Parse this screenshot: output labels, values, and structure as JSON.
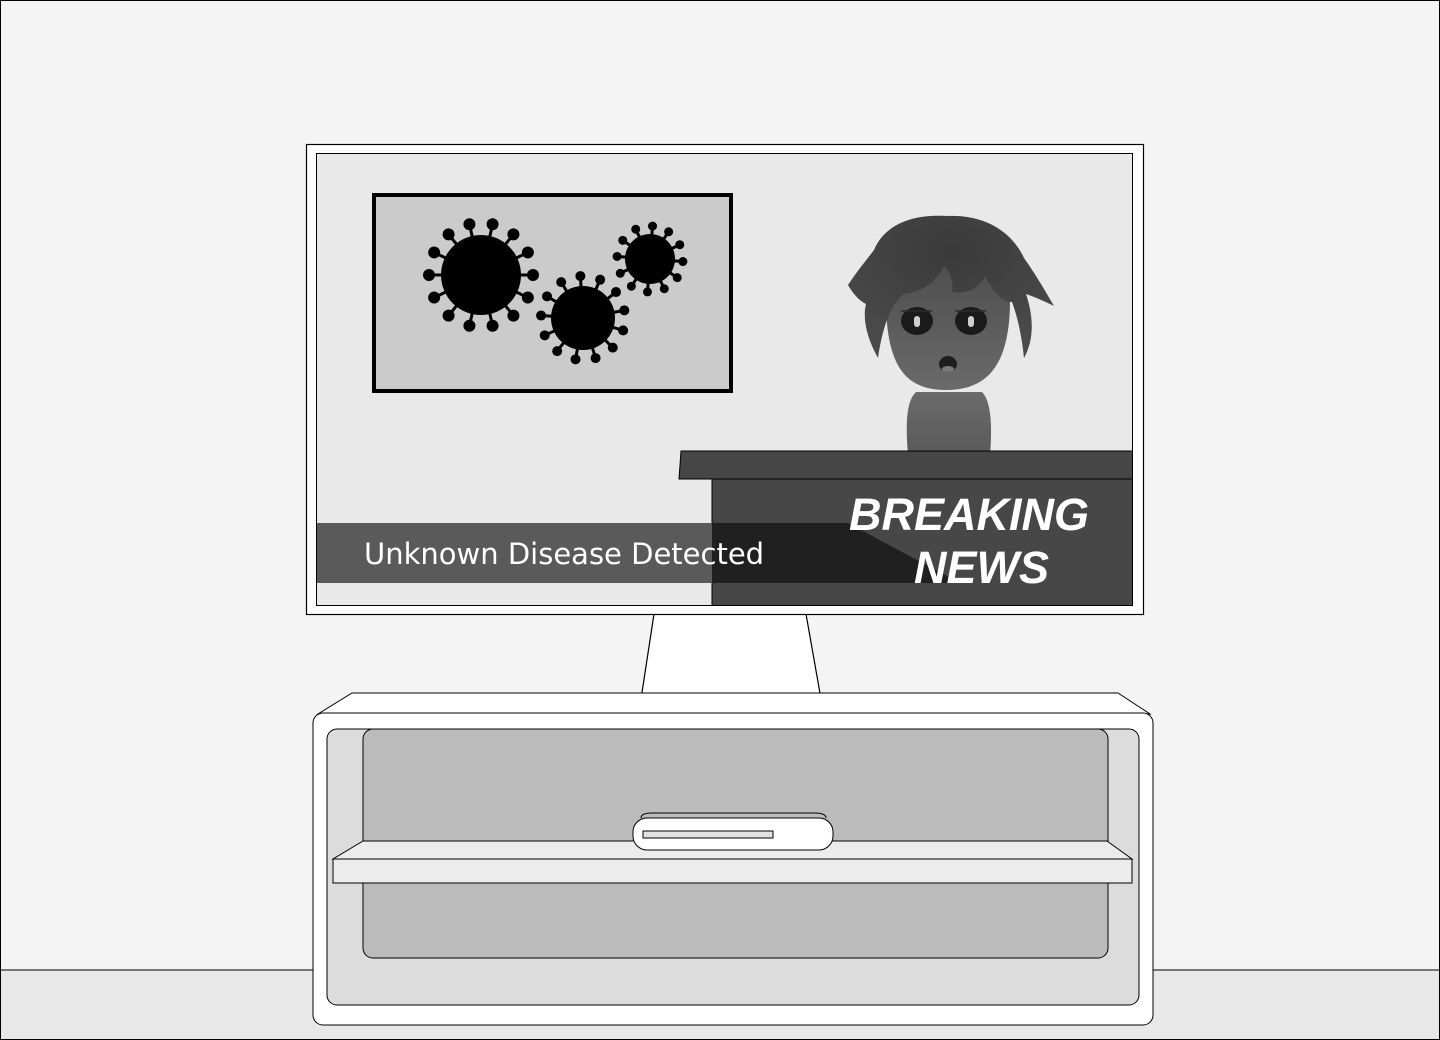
{
  "broadcast": {
    "headline": "Unknown Disease Detected",
    "banner_line1": "BREAKING",
    "banner_line2": "NEWS"
  },
  "palette": {
    "wall": "#f4f4f4",
    "floor": "#e8e8e8",
    "screen": "#e9e9e9",
    "desk": "#464646",
    "ticker": "#5a5a5a",
    "virus": "#000000",
    "cabinet": "#efefef",
    "cabinet_inner": "#bbbbbb"
  }
}
